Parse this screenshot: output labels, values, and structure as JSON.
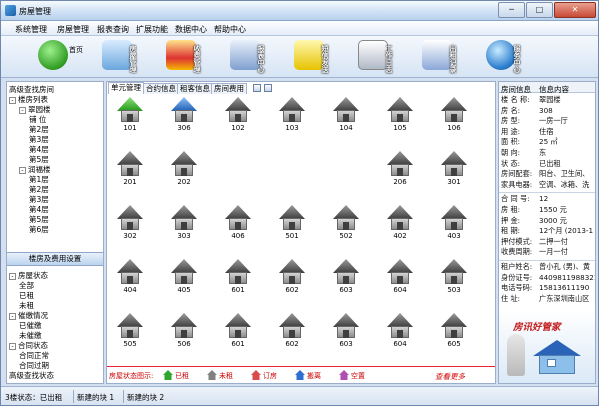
{
  "window": {
    "title": "房屋管理",
    "min_label": "─",
    "max_label": "□",
    "close_label": "✕"
  },
  "menu": [
    "系统管理",
    "房屋管理",
    "报表查询",
    "扩展功能",
    "数据中心",
    "帮助中心"
  ],
  "toolbar": [
    {
      "label": "首页",
      "icon": "home-icon"
    },
    {
      "label": "房屋管理",
      "icon": "house-icon"
    },
    {
      "label": "收费管理",
      "icon": "money-icon"
    },
    {
      "label": "报表中心",
      "icon": "report-icon"
    },
    {
      "label": "短信发送",
      "icon": "sms-icon"
    },
    {
      "label": "工作日志",
      "icon": "log-icon"
    },
    {
      "label": "出租记录",
      "icon": "pay-icon"
    },
    {
      "label": "服务中心",
      "icon": "server-icon"
    }
  ],
  "tree": {
    "items": [
      {
        "text": "高级查找房间",
        "level": 0,
        "box": ""
      },
      {
        "text": "楼房列表",
        "level": 0,
        "box": "-"
      },
      {
        "text": "翠园楼",
        "level": 1,
        "box": "-"
      },
      {
        "text": "铺 位",
        "level": 2,
        "box": ""
      },
      {
        "text": "第2层",
        "level": 2,
        "box": ""
      },
      {
        "text": "第3层",
        "level": 2,
        "box": ""
      },
      {
        "text": "第4层",
        "level": 2,
        "box": ""
      },
      {
        "text": "第5层",
        "level": 2,
        "box": ""
      },
      {
        "text": "润福楼",
        "level": 1,
        "box": "-"
      },
      {
        "text": "第1层",
        "level": 2,
        "box": ""
      },
      {
        "text": "第2层",
        "level": 2,
        "box": ""
      },
      {
        "text": "第3层",
        "level": 2,
        "box": ""
      },
      {
        "text": "第4层",
        "level": 2,
        "box": ""
      },
      {
        "text": "第5层",
        "level": 2,
        "box": ""
      },
      {
        "text": "第6层",
        "level": 2,
        "box": ""
      }
    ]
  },
  "panel_title": "楼房及费用设置",
  "status_tree": {
    "items": [
      {
        "text": "房屋状态",
        "level": 0,
        "box": "-"
      },
      {
        "text": "全部",
        "level": 1,
        "box": ""
      },
      {
        "text": "已租",
        "level": 1,
        "box": ""
      },
      {
        "text": "未租",
        "level": 1,
        "box": ""
      },
      {
        "text": "催缴情况",
        "level": 0,
        "box": "-"
      },
      {
        "text": "已催缴",
        "level": 1,
        "box": ""
      },
      {
        "text": "未催缴",
        "level": 1,
        "box": ""
      },
      {
        "text": "合同状态",
        "level": 0,
        "box": "-"
      },
      {
        "text": "合同正常",
        "level": 1,
        "box": ""
      },
      {
        "text": "合同过期",
        "level": 1,
        "box": ""
      },
      {
        "text": "高级查找状态",
        "level": 0,
        "box": ""
      }
    ]
  },
  "tabs": [
    "单元管理",
    "合约信息",
    "租客信息",
    "房间费用"
  ],
  "rooms": [
    {
      "num": "101",
      "status": "green"
    },
    {
      "num": "306",
      "status": "blue"
    },
    {
      "num": "102",
      "status": "gray"
    },
    {
      "num": "103",
      "status": "gray"
    },
    {
      "num": "104",
      "status": "gray"
    },
    {
      "num": "105",
      "status": "gray"
    },
    {
      "num": "106",
      "status": "gray"
    },
    {
      "num": "201",
      "status": "gray"
    },
    {
      "num": "202",
      "status": "gray"
    },
    {
      "num": "",
      "status": "none"
    },
    {
      "num": "",
      "status": "none"
    },
    {
      "num": "",
      "status": "none"
    },
    {
      "num": "206",
      "status": "gray"
    },
    {
      "num": "301",
      "status": "gray"
    },
    {
      "num": "302",
      "status": "gray"
    },
    {
      "num": "303",
      "status": "gray"
    },
    {
      "num": "406",
      "status": "gray"
    },
    {
      "num": "501",
      "status": "gray"
    },
    {
      "num": "502",
      "status": "gray"
    },
    {
      "num": "402",
      "status": "gray"
    },
    {
      "num": "403",
      "status": "gray"
    },
    {
      "num": "404",
      "status": "gray"
    },
    {
      "num": "405",
      "status": "gray"
    },
    {
      "num": "601",
      "status": "gray"
    },
    {
      "num": "602",
      "status": "gray"
    },
    {
      "num": "603",
      "status": "gray"
    },
    {
      "num": "604",
      "status": "gray"
    },
    {
      "num": "503",
      "status": "gray"
    },
    {
      "num": "505",
      "status": "gray"
    },
    {
      "num": "506",
      "status": "gray"
    },
    {
      "num": "601",
      "status": "gray"
    },
    {
      "num": "602",
      "status": "gray"
    },
    {
      "num": "603",
      "status": "gray"
    },
    {
      "num": "604",
      "status": "gray"
    },
    {
      "num": "605",
      "status": "gray"
    }
  ],
  "legend": {
    "title": "房屋状态图示:",
    "items": [
      {
        "label": "已租",
        "color": "#2fa52f"
      },
      {
        "label": "未租",
        "color": "#808080"
      },
      {
        "label": "订房",
        "color": "#d94a4a"
      },
      {
        "label": "搬离",
        "color": "#2f6fd0"
      },
      {
        "label": "空置",
        "color": "#b04fb0"
      }
    ],
    "more": "查看更多"
  },
  "info": {
    "header_left": "房间信息",
    "header_right": "信息内容",
    "rows": [
      {
        "k": "楼 名 称:",
        "v": "翠园楼"
      },
      {
        "k": "房    名:",
        "v": "308"
      },
      {
        "k": "房    型:",
        "v": "一房一厅"
      },
      {
        "k": "用    途:",
        "v": "住宿"
      },
      {
        "k": "面    积:",
        "v": "25 ㎡"
      },
      {
        "k": "朝    向:",
        "v": "东"
      },
      {
        "k": "状    态:",
        "v": "已出租"
      },
      {
        "k": "房间配套:",
        "v": "阳台、卫生间、"
      },
      {
        "k": "家具电器:",
        "v": "空调、冰箱、洗"
      },
      {
        "k": "合 同 号:",
        "v": "12"
      },
      {
        "k": "房    租:",
        "v": "1550 元"
      },
      {
        "k": "押    金:",
        "v": "3000 元"
      },
      {
        "k": "租    期:",
        "v": "12个月 (2013-1"
      },
      {
        "k": "押付模式:",
        "v": "二押一付"
      },
      {
        "k": "收费周期:",
        "v": "一月一付"
      },
      {
        "k": "租户姓名:",
        "v": "曾小孔 (男)、黄"
      },
      {
        "k": "身份证号:",
        "v": "44098119883214"
      },
      {
        "k": "电话号码:",
        "v": "15813611190"
      },
      {
        "k": "住    址:",
        "v": "广东深圳南山区"
      }
    ]
  },
  "ad": {
    "text": "房讯好管家"
  },
  "statusbar": {
    "left": "3楼状态：已出租",
    "mid": "新建的块 1",
    "right": "新建的块 2"
  }
}
